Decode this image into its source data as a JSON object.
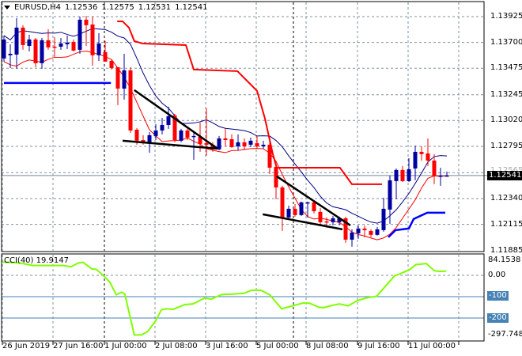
{
  "header": {
    "symbol": "EURUSD,H4",
    "open": "1.12536",
    "high": "1.12575",
    "low": "1.12531",
    "close": "1.12541"
  },
  "price_axis": [
    "1.13925",
    "1.13700",
    "1.13475",
    "1.13245",
    "1.13020",
    "1.12795",
    "1.12565",
    "1.12340",
    "1.12115",
    "1.11885"
  ],
  "current_price": "1.12541",
  "time_axis": [
    "26 Jun 2019",
    "27 Jun 16:00",
    "1 Jul 00:00",
    "2 Jul 08:00",
    "3 Jul 16:00",
    "5 Jul 00:00",
    "8 Jul 08:00",
    "9 Jul 16:00",
    "11 Jul 00:00"
  ],
  "indicator": {
    "title": "CCI(40) 19.9147",
    "axis": [
      "84.1538",
      "0.00",
      "-100",
      "-200",
      "-297.7482"
    ]
  },
  "colors": {
    "bull": "#0000a0",
    "bear": "#ff0000",
    "cci": "#7fff00",
    "level": "#4682b4",
    "ma_upper": "#000080",
    "ma_lower": "#ff0000"
  },
  "chart_data": {
    "type": "candlestick",
    "candles_ohlc": [
      [
        1.1356,
        1.1376,
        1.13533,
        1.13726
      ],
      [
        1.13588,
        1.13684,
        1.13477,
        1.13601
      ],
      [
        1.13594,
        1.13912,
        1.13471,
        1.13829
      ],
      [
        1.13829,
        1.1385,
        1.13636,
        1.13677
      ],
      [
        1.1367,
        1.13767,
        1.13622,
        1.13726
      ],
      [
        1.13726,
        1.13739,
        1.13484,
        1.13519
      ],
      [
        1.13519,
        1.13739,
        1.13471,
        1.13719
      ],
      [
        1.13719,
        1.13815,
        1.13636,
        1.13657
      ],
      [
        1.13663,
        1.13746,
        1.13574,
        1.13657
      ],
      [
        1.13663,
        1.13739,
        1.13636,
        1.13691
      ],
      [
        1.13684,
        1.1376,
        1.13643,
        1.13698
      ],
      [
        1.13705,
        1.13726,
        1.13622,
        1.13629
      ],
      [
        1.13636,
        1.13925,
        1.13601,
        1.13898
      ],
      [
        1.13898,
        1.13932,
        1.1367,
        1.1385
      ],
      [
        1.13856,
        1.13925,
        1.13498,
        1.13588
      ],
      [
        1.13588,
        1.13781,
        1.13539,
        1.13691
      ],
      [
        1.13615,
        1.13712,
        1.13533,
        1.13533
      ],
      [
        1.13539,
        1.13553,
        1.13464,
        1.13477
      ],
      [
        1.13484,
        1.13484,
        1.13154,
        1.13298
      ],
      [
        1.13298,
        1.13601,
        1.13202,
        1.13457
      ],
      [
        1.13457,
        1.13484,
        1.12912,
        1.12933
      ],
      [
        1.1294,
        1.12954,
        1.12809,
        1.12844
      ],
      [
        1.1285,
        1.12892,
        1.12809,
        1.1283
      ],
      [
        1.1283,
        1.12919,
        1.1274,
        1.12892
      ],
      [
        1.12885,
        1.12988,
        1.1285,
        1.12933
      ],
      [
        1.12933,
        1.13043,
        1.12899,
        1.12981
      ],
      [
        1.12981,
        1.1314,
        1.12947,
        1.13057
      ],
      [
        1.13064,
        1.13078,
        1.1283,
        1.1285
      ],
      [
        1.12844,
        1.12947,
        1.1283,
        1.12933
      ],
      [
        1.12933,
        1.12947,
        1.1285,
        1.12871
      ],
      [
        1.12878,
        1.12926,
        1.12678,
        1.12885
      ],
      [
        1.12878,
        1.13002,
        1.12747,
        1.12816
      ],
      [
        1.12823,
        1.13126,
        1.12713,
        1.12809
      ],
      [
        1.12809,
        1.1283,
        1.12747,
        1.12768
      ],
      [
        1.12768,
        1.12885,
        1.12761,
        1.12864
      ],
      [
        1.12864,
        1.12947,
        1.12795,
        1.1285
      ],
      [
        1.12857,
        1.12899,
        1.12782,
        1.12788
      ],
      [
        1.12795,
        1.12899,
        1.12761,
        1.1283
      ],
      [
        1.1283,
        1.12864,
        1.12761,
        1.12795
      ],
      [
        1.12809,
        1.12871,
        1.12788,
        1.12844
      ],
      [
        1.12823,
        1.12885,
        1.12775,
        1.12795
      ],
      [
        1.12795,
        1.12844,
        1.12775,
        1.12809
      ],
      [
        1.12809,
        1.12864,
        1.12554,
        1.12609
      ],
      [
        1.12616,
        1.12644,
        1.12334,
        1.12437
      ],
      [
        1.12437,
        1.12451,
        1.12058,
        1.12175
      ],
      [
        1.12175,
        1.12279,
        1.12155,
        1.12251
      ],
      [
        1.12251,
        1.12292,
        1.12182,
        1.12196
      ],
      [
        1.12196,
        1.12313,
        1.12189,
        1.12307
      ],
      [
        1.123,
        1.12313,
        1.12175,
        1.12307
      ],
      [
        1.12307,
        1.12327,
        1.1221,
        1.1223
      ],
      [
        1.12224,
        1.12258,
        1.12106,
        1.12134
      ],
      [
        1.12141,
        1.12175,
        1.12086,
        1.12134
      ],
      [
        1.12134,
        1.12189,
        1.12106,
        1.12168
      ],
      [
        1.12134,
        1.12182,
        1.12106,
        1.12168
      ],
      [
        1.12168,
        1.12182,
        1.11955,
        1.11982
      ],
      [
        1.11982,
        1.12072,
        1.1192,
        1.12044
      ],
      [
        1.12037,
        1.12106,
        1.11989,
        1.12079
      ],
      [
        1.12079,
        1.12106,
        1.12003,
        1.12065
      ],
      [
        1.12058,
        1.12072,
        1.12003,
        1.12024
      ],
      [
        1.12024,
        1.12093,
        1.12017,
        1.12072
      ],
      [
        1.12065,
        1.12348,
        1.12051,
        1.12251
      ],
      [
        1.12244,
        1.1254,
        1.1212,
        1.12499
      ],
      [
        1.12492,
        1.12602,
        1.12334,
        1.12589
      ],
      [
        1.12589,
        1.12623,
        1.12485,
        1.12492
      ],
      [
        1.12492,
        1.12692,
        1.12485,
        1.12595
      ],
      [
        1.12602,
        1.12802,
        1.12499,
        1.12747
      ],
      [
        1.12747,
        1.12795,
        1.12671,
        1.12727
      ],
      [
        1.12733,
        1.12864,
        1.12623,
        1.12671
      ],
      [
        1.12671,
        1.12727,
        1.12465,
        1.12534
      ],
      [
        1.12534,
        1.12609,
        1.12451,
        1.1254
      ],
      [
        1.12536,
        1.12575,
        1.12531,
        1.12541
      ]
    ],
    "red_stop_line": [
      [
        18.9,
        1.13884
      ],
      [
        19.75,
        1.13884
      ],
      [
        20.75,
        1.13829
      ],
      [
        21.6,
        1.13712
      ],
      [
        22.9,
        1.13691
      ],
      [
        29.75,
        1.13677
      ],
      [
        31,
        1.13464
      ],
      [
        37.9,
        1.1345
      ],
      [
        38.5,
        1.13416
      ],
      [
        41,
        1.13278
      ],
      [
        42.25,
        1.13037
      ],
      [
        43.5,
        1.12727
      ],
      [
        44.1,
        1.12609
      ],
      [
        54.1,
        1.12609
      ],
      [
        56,
        1.12465
      ],
      [
        60.75,
        1.12465
      ]
    ],
    "blue_stop_lines": [
      [
        [
          1,
          1.13347
        ],
        [
          17.9,
          1.13347
        ]
      ],
      [
        [
          61.75,
          1.12003
        ],
        [
          62.9,
          1.12065
        ],
        [
          65,
          1.12079
        ],
        [
          65.75,
          1.12162
        ],
        [
          67.9,
          1.12217
        ],
        [
          70.75,
          1.12217
        ]
      ]
    ],
    "trendlines": [
      [
        [
          21.6,
          1.13285
        ],
        [
          34.75,
          1.12775
        ]
      ],
      [
        [
          19.75,
          1.12844
        ],
        [
          34.75,
          1.12775
        ]
      ],
      [
        [
          44.1,
          1.12534
        ],
        [
          55.75,
          1.12106
        ]
      ],
      [
        [
          41.9,
          1.12203
        ],
        [
          54.5,
          1.12072
        ]
      ]
    ],
    "cci": [
      [
        0.75,
        62
      ],
      [
        3.5,
        58
      ],
      [
        5.6,
        46
      ],
      [
        10.4,
        46
      ],
      [
        11.6,
        40
      ],
      [
        12.75,
        58
      ],
      [
        13.5,
        61
      ],
      [
        14.9,
        30
      ],
      [
        15.6,
        28
      ],
      [
        17,
        -9
      ],
      [
        17.75,
        -33
      ],
      [
        18.75,
        -91
      ],
      [
        19.6,
        -79
      ],
      [
        20.1,
        -88
      ],
      [
        21.6,
        -279
      ],
      [
        22.75,
        -279
      ],
      [
        23.75,
        -262
      ],
      [
        24.9,
        -216
      ],
      [
        25.9,
        -161
      ],
      [
        26.6,
        -157
      ],
      [
        27.75,
        -159
      ],
      [
        29.6,
        -137
      ],
      [
        30.9,
        -134
      ],
      [
        32.75,
        -106
      ],
      [
        33.75,
        -112
      ],
      [
        35.4,
        -90
      ],
      [
        37.25,
        -88
      ],
      [
        39,
        -84
      ],
      [
        40.1,
        -70
      ],
      [
        41.6,
        -70
      ],
      [
        43,
        -91
      ],
      [
        44.9,
        -157
      ],
      [
        46.6,
        -143
      ],
      [
        48.25,
        -130
      ],
      [
        49.25,
        -130
      ],
      [
        50.9,
        -151
      ],
      [
        51.6,
        -151
      ],
      [
        53,
        -140
      ],
      [
        54,
        -134
      ],
      [
        55.4,
        -143
      ],
      [
        56.9,
        -118
      ],
      [
        58.25,
        -106
      ],
      [
        59.9,
        -98
      ],
      [
        62.75,
        -2
      ],
      [
        63.5,
        6
      ],
      [
        65.1,
        26
      ],
      [
        66.1,
        50
      ],
      [
        67.75,
        55
      ],
      [
        69,
        22
      ],
      [
        69.9,
        18
      ],
      [
        70.9,
        20
      ]
    ],
    "price_range": [
      1.11885,
      1.13925
    ],
    "cci_levels": [
      0,
      -100,
      -200
    ]
  }
}
